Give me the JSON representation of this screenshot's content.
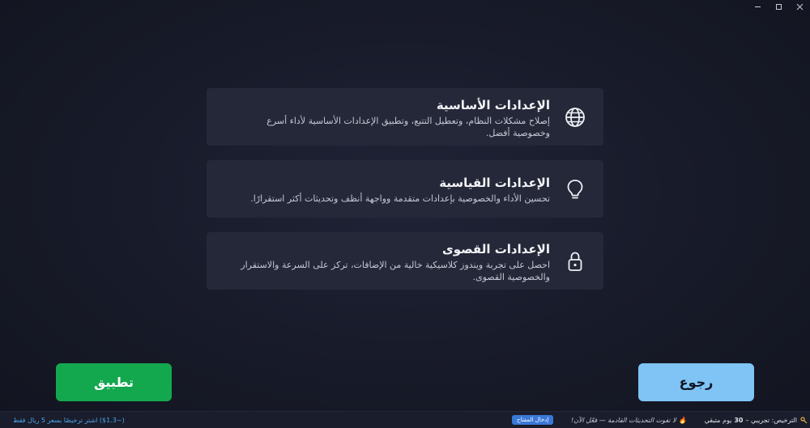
{
  "window": {
    "minimize_icon": "minimize-icon",
    "maximize_icon": "maximize-icon",
    "close_icon": "close-icon"
  },
  "cards": [
    {
      "icon": "globe-icon",
      "title": "الإعدادات الأساسية",
      "description": "إصلاح مشكلات النظام، وتعطيل التتبع، وتطبيق الإعدادات الأساسية لأداء أسرع وخصوصية أفضل."
    },
    {
      "icon": "lightbulb-icon",
      "title": "الإعدادات القياسية",
      "description": "تحسين الأداء والخصوصية بإعدادات متقدمة وواجهة أنظف وتحديثات أكثر استقرارًا."
    },
    {
      "icon": "lock-icon",
      "title": "الإعدادات القصوى",
      "description": "احصل على تجربة ويندوز كلاسيكية خالية من الإضافات، تركز على السرعة والاستقرار والخصوصية القصوى."
    }
  ],
  "buttons": {
    "apply_label": "تطبيق",
    "back_label": "رجوع"
  },
  "statusbar": {
    "buy_link": "اشتر ترخيصًا بسعر 5 ريال فقط (‎$1.3~)",
    "enter_key_label": "إدخال المفتاح",
    "promo_text": "لا تفوت التحديثات القادمة — فعّل الآن!",
    "license_label": "الترخيص: تجريبي –",
    "days_count": "30",
    "days_label": "يوم متبقي"
  }
}
